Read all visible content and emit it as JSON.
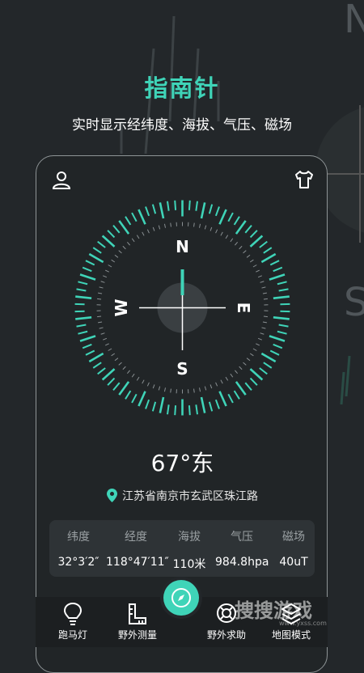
{
  "header": {
    "title": "指南针",
    "subtitle": "实时显示经纬度、海拔、气压、磁场"
  },
  "compass": {
    "north": "N",
    "south": "S",
    "east": "E",
    "west": "W",
    "heading": "67°东"
  },
  "location": {
    "address": "江苏省南京市玄武区珠江路"
  },
  "stats": [
    {
      "label": "纬度",
      "value": "32°3′2″"
    },
    {
      "label": "经度",
      "value": "118°47′11″"
    },
    {
      "label": "海拔",
      "value": "110米"
    },
    {
      "label": "气压",
      "value": "984.8hpa"
    },
    {
      "label": "磁场",
      "value": "40uT"
    }
  ],
  "nav": [
    {
      "label": "跑马灯",
      "icon": "bulb-icon"
    },
    {
      "label": "野外测量",
      "icon": "ruler-icon"
    },
    {
      "label": "野外求助",
      "icon": "lifebuoy-icon"
    },
    {
      "label": "地图模式",
      "icon": "layers-icon"
    }
  ],
  "watermark": {
    "text": "捜搜游戏",
    "sub": "www.yxss.com"
  },
  "colors": {
    "accent": "#3fd4b8",
    "background": "#23272a"
  }
}
